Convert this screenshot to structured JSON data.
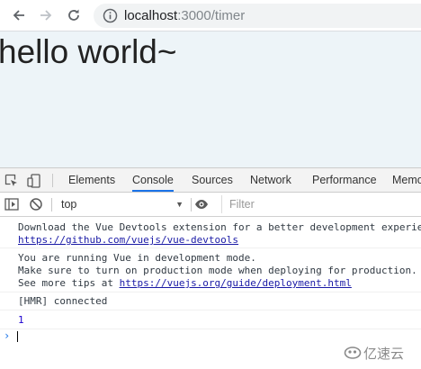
{
  "browser": {
    "url_host": "localhost",
    "url_path": ":3000/timer"
  },
  "page": {
    "heading": "hello world~"
  },
  "devtools": {
    "tabs": [
      "Elements",
      "Console",
      "Sources",
      "Network",
      "Performance",
      "Memo"
    ],
    "active_tab": "Console",
    "context": "top",
    "filter_placeholder": "Filter"
  },
  "console": {
    "messages": [
      {
        "lines": [
          "Download the Vue Devtools extension for a better development experie",
          "https://github.com/vuejs/vue-devtools"
        ]
      },
      {
        "lines": [
          "You are running Vue in development mode.",
          "Make sure to turn on production mode when deploying for production.",
          "See more tips at ",
          "https://vuejs.org/guide/deployment.html"
        ]
      },
      {
        "lines": [
          "[HMR] connected"
        ]
      },
      {
        "lines": [
          "1"
        ]
      }
    ]
  },
  "watermark": {
    "text": "亿速云"
  },
  "colors": {
    "accent": "#1a73e8",
    "page_bg": "#edf4f8",
    "link": "#1a1aa6",
    "number": "#1c00cf"
  }
}
